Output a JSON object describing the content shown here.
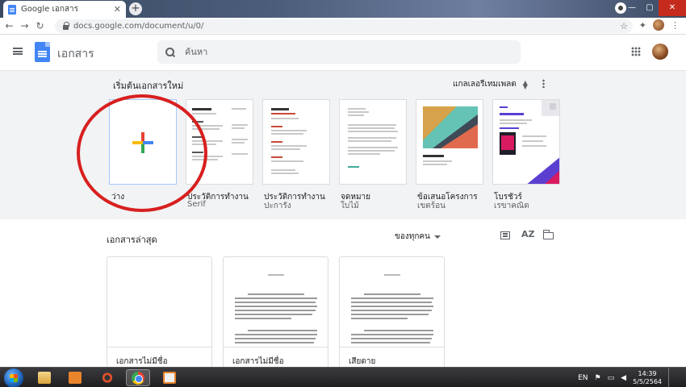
{
  "browser": {
    "tab_title": "Google เอกสาร",
    "tab_close": "✕",
    "new_tab": "+",
    "url": "docs.google.com/document/u/0/",
    "window_controls": [
      "—",
      "▢",
      "✕"
    ],
    "nav": {
      "back": "←",
      "forward": "→",
      "reload": "↻"
    },
    "icons": {
      "star": "☆",
      "extensions": "✦",
      "menu": "⋮"
    }
  },
  "docs": {
    "app_name": "เอกสาร",
    "search_placeholder": "ค้นหา"
  },
  "templates": {
    "heading": "เริ่มต้นเอกสารใหม่",
    "gallery_label": "แกลเลอรีเทมเพลต",
    "items": [
      {
        "name": "ว่าง",
        "sub": ""
      },
      {
        "name": "ประวัติการทำงาน",
        "sub": "Serif"
      },
      {
        "name": "ประวัติการทำงาน",
        "sub": "ปะการัง"
      },
      {
        "name": "จดหมาย",
        "sub": "ใบไม้"
      },
      {
        "name": "ข้อเสนอโครงการ",
        "sub": "เขตร้อน"
      },
      {
        "name": "โบรชัวร์",
        "sub": "เรขาคณิต"
      }
    ]
  },
  "recent": {
    "title": "เอกสารล่าสุด",
    "owner_filter": "ของทุกคน",
    "sort_icon_text": "AZ",
    "documents": [
      {
        "name": "เอกสารไม่มีชื่อ"
      },
      {
        "name": "เอกสารไม่มีชื่อ"
      },
      {
        "name": "เสียดาย"
      }
    ]
  },
  "taskbar": {
    "language": "EN",
    "time": "14:39",
    "date": "5/5/2564"
  },
  "colors": {
    "accent_blue": "#4285f4",
    "annotation_red": "#d81f1f",
    "template_bg": "#f1f3f4"
  }
}
